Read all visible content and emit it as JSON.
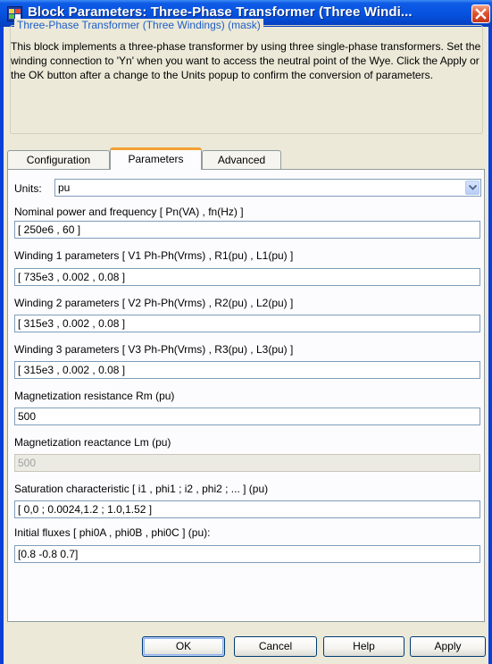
{
  "window": {
    "title": "Block Parameters: Three-Phase Transformer (Three Windi...",
    "colors": {
      "titlebar": "#0653e0",
      "client": "#ece9d8",
      "close": "#df5330",
      "mask_title": "#1d5ec8"
    }
  },
  "mask": {
    "title": "Three-Phase Transformer (Three Windings) (mask)",
    "description": "This block implements a three-phase transformer by using three single-phase transformers. Set the winding connection to 'Yn' when you want to access the neutral point of the Wye. Click the Apply or the OK button after a change to the Units popup to confirm the conversion of parameters."
  },
  "tabs": [
    {
      "label": "Configuration",
      "active": false
    },
    {
      "label": "Parameters",
      "active": true
    },
    {
      "label": "Advanced",
      "active": false
    }
  ],
  "parameters": {
    "units_label": "Units:",
    "units_value": "pu",
    "fields": [
      {
        "label": "Nominal power and frequency [ Pn(VA) , fn(Hz) ]",
        "value": "[ 250e6 , 60 ]",
        "enabled": true
      },
      {
        "label": "Winding 1 parameters [ V1 Ph-Ph(Vrms) , R1(pu) , L1(pu) ]",
        "value": "[ 735e3 , 0.002 , 0.08 ]",
        "enabled": true
      },
      {
        "label": "Winding 2 parameters [ V2 Ph-Ph(Vrms) , R2(pu) , L2(pu) ]",
        "value": "[ 315e3 , 0.002 , 0.08 ]",
        "enabled": true
      },
      {
        "label": "Winding 3 parameters [ V3 Ph-Ph(Vrms) , R3(pu) , L3(pu) ]",
        "value": "[ 315e3 , 0.002 , 0.08 ]",
        "enabled": true
      },
      {
        "label": "Magnetization resistance Rm (pu)",
        "value": "500",
        "enabled": true
      },
      {
        "label": "Magnetization reactance Lm (pu)",
        "value": "500",
        "enabled": false
      },
      {
        "label": "Saturation characteristic [ i1 , phi1 ; i2 , phi2 ; ... ] (pu)",
        "value": "[ 0,0 ; 0.0024,1.2 ; 1.0,1.52 ]",
        "enabled": true
      },
      {
        "label": "Initial fluxes [ phi0A , phi0B , phi0C ] (pu):",
        "value": "[0.8 -0.8 0.7]",
        "enabled": true
      }
    ]
  },
  "buttons": {
    "ok": "OK",
    "cancel": "Cancel",
    "help": "Help",
    "apply": "Apply"
  },
  "icons": {
    "app": "simulink-block-icon",
    "close": "close-icon",
    "dropdown": "chevron-down-icon"
  }
}
